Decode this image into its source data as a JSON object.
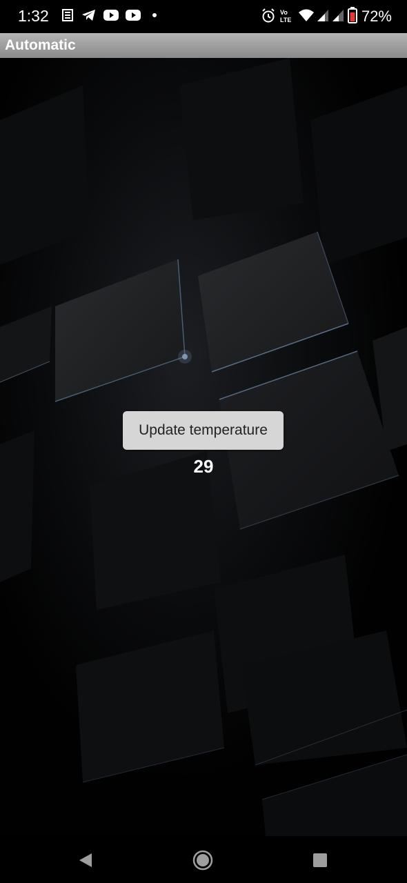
{
  "status_bar": {
    "time": "1:32",
    "battery_percent": "72%",
    "icons": [
      "news-icon",
      "telegram-icon",
      "youtube-icon",
      "youtube-icon",
      "dot-icon",
      "alarm-icon",
      "volte-icon",
      "wifi-icon",
      "signal-icon",
      "signal-icon",
      "battery-icon"
    ]
  },
  "action_bar": {
    "title": "Automatic"
  },
  "main": {
    "update_button_label": "Update temperature",
    "temperature": "29"
  },
  "nav_bar": {
    "icons": [
      "back-icon",
      "home-icon",
      "recents-icon"
    ]
  },
  "colors": {
    "action_bar": "#9e9e9e",
    "button_bg": "#d6d6d6",
    "background": "#000000"
  }
}
